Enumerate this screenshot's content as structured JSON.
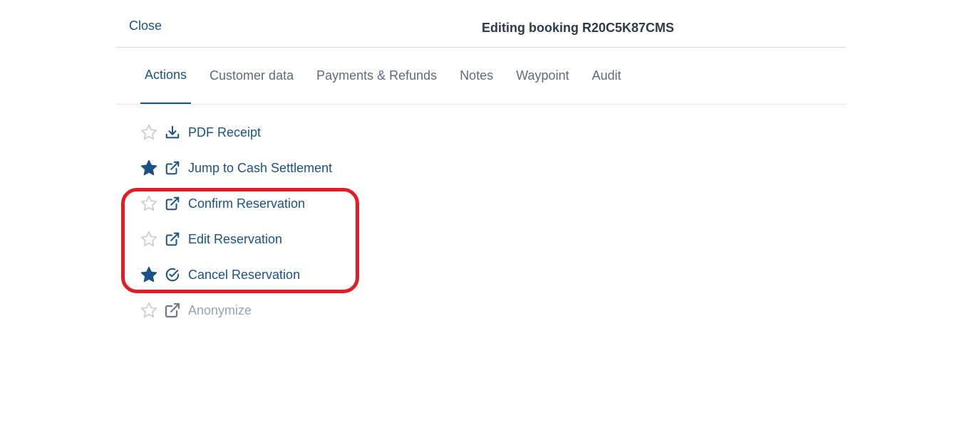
{
  "header": {
    "close_label": "Close",
    "title": "Editing booking R20C5K87CMS"
  },
  "tabs": [
    {
      "label": "Actions",
      "active": true
    },
    {
      "label": "Customer data",
      "active": false
    },
    {
      "label": "Payments & Refunds",
      "active": false
    },
    {
      "label": "Notes",
      "active": false
    },
    {
      "label": "Waypoint",
      "active": false
    },
    {
      "label": "Audit",
      "active": false
    }
  ],
  "actions": [
    {
      "label": "PDF Receipt",
      "starred": false,
      "icon": "download-icon",
      "enabled": true
    },
    {
      "label": "Jump to Cash Settlement",
      "starred": true,
      "icon": "external-link-icon",
      "enabled": true
    },
    {
      "label": "Confirm Reservation",
      "starred": false,
      "icon": "external-link-icon",
      "enabled": true
    },
    {
      "label": "Edit Reservation",
      "starred": false,
      "icon": "external-link-icon",
      "enabled": true
    },
    {
      "label": "Cancel Reservation",
      "starred": true,
      "icon": "check-circle-icon",
      "enabled": true
    },
    {
      "label": "Anonymize",
      "starred": false,
      "icon": "external-link-icon",
      "enabled": false
    }
  ],
  "colors": {
    "primary": "#1a5287",
    "muted_text": "#5f6b78",
    "disabled": "#9aa2ad",
    "star_empty": "#c9ced5",
    "highlight": "#e11d25"
  }
}
